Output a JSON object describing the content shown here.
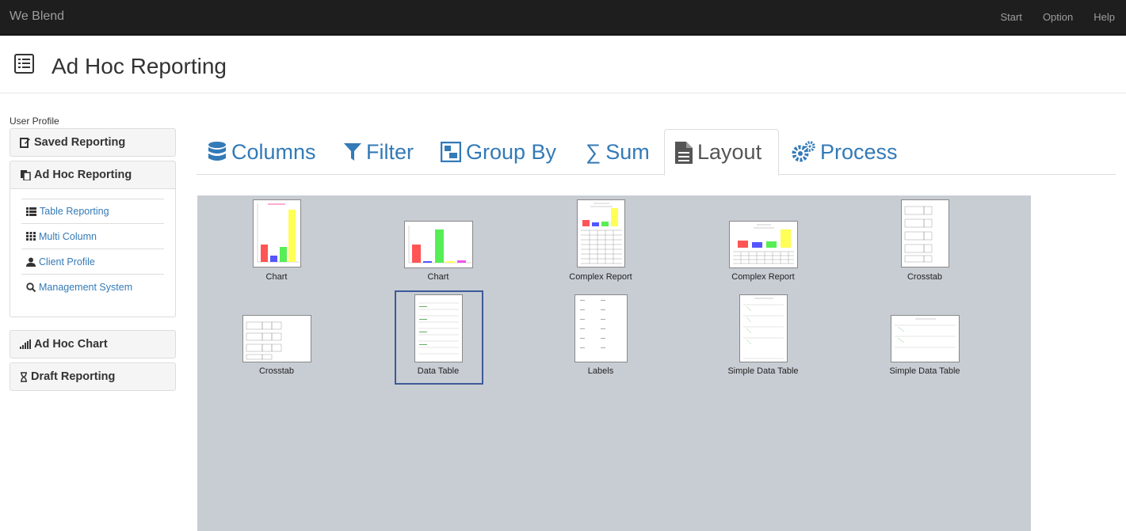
{
  "app": {
    "brand": "We Blend",
    "nav": [
      "Start",
      "Option",
      "Help"
    ]
  },
  "header": {
    "title": "Ad Hoc Reporting"
  },
  "sidebar": {
    "profile_label": "User Profile",
    "saved": "Saved Reporting",
    "adhoc": "Ad Hoc Reporting",
    "links": [
      "Table Reporting",
      "Multi Column",
      "Client Profile",
      "Management System"
    ],
    "chart": "Ad Hoc Chart",
    "draft": "Draft Reporting"
  },
  "tabs": [
    "Columns",
    "Filter",
    "Group By",
    "Sum",
    "Layout",
    "Process"
  ],
  "active_tab": "Layout",
  "accent_color": "#337ab7",
  "layouts": [
    {
      "label": "Chart",
      "kind": "chart-tall"
    },
    {
      "label": "Chart",
      "kind": "chart-wide"
    },
    {
      "label": "Complex Report",
      "kind": "complex-tall"
    },
    {
      "label": "Complex Report",
      "kind": "complex-wide"
    },
    {
      "label": "Crosstab",
      "kind": "crosstab-tall"
    },
    {
      "label": "Crosstab",
      "kind": "crosstab-wide"
    },
    {
      "label": "Data Table",
      "kind": "datatable",
      "selected": true
    },
    {
      "label": "Labels",
      "kind": "labels"
    },
    {
      "label": "Simple Data Table",
      "kind": "simple-tall"
    },
    {
      "label": "Simple Data Table",
      "kind": "simple-wide"
    }
  ]
}
